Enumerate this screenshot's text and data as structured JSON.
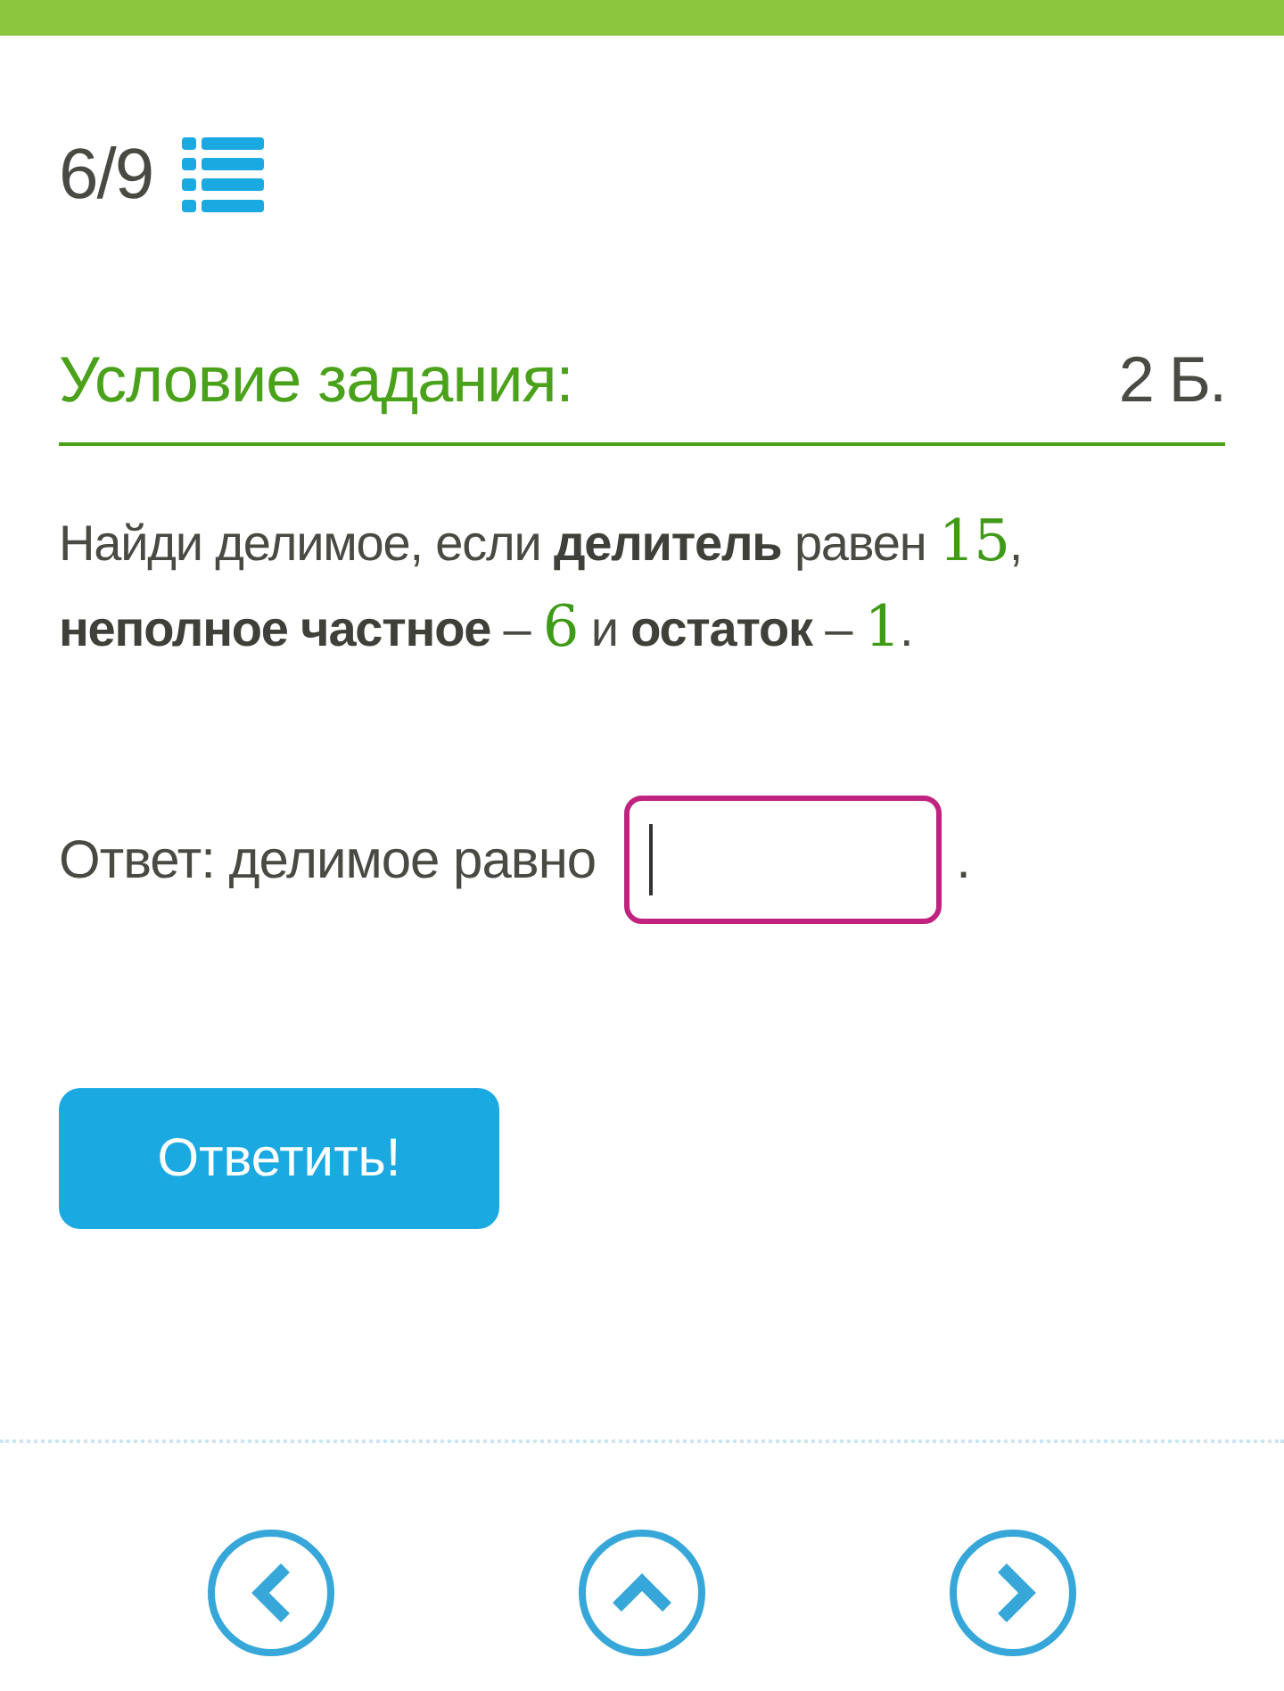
{
  "progress": {
    "counter": "6/9"
  },
  "task": {
    "title": "Условие задания:",
    "points": "2 Б."
  },
  "problem": {
    "lines": [
      [
        {
          "kind": "plain",
          "text": "Найди делимое, если "
        },
        {
          "kind": "bold",
          "text": "делитель"
        },
        {
          "kind": "plain",
          "text": " равен "
        },
        {
          "kind": "number",
          "text": "15"
        },
        {
          "kind": "plain",
          "text": ","
        }
      ],
      [
        {
          "kind": "bold",
          "text": "неполное частное"
        },
        {
          "kind": "plain",
          "text": " – "
        },
        {
          "kind": "number",
          "text": "6"
        },
        {
          "kind": "plain",
          "text": " и "
        },
        {
          "kind": "bold",
          "text": "остаток"
        },
        {
          "kind": "plain",
          "text": " – "
        },
        {
          "kind": "number",
          "text": "1"
        },
        {
          "kind": "plain",
          "text": "."
        }
      ]
    ]
  },
  "answer": {
    "label": "Ответ: делимое равно",
    "focused": true,
    "suffix": "."
  },
  "submit": {
    "label": "Ответить!"
  },
  "nav": [
    {
      "kind": "prev"
    },
    {
      "kind": "up"
    },
    {
      "kind": "next"
    }
  ]
}
